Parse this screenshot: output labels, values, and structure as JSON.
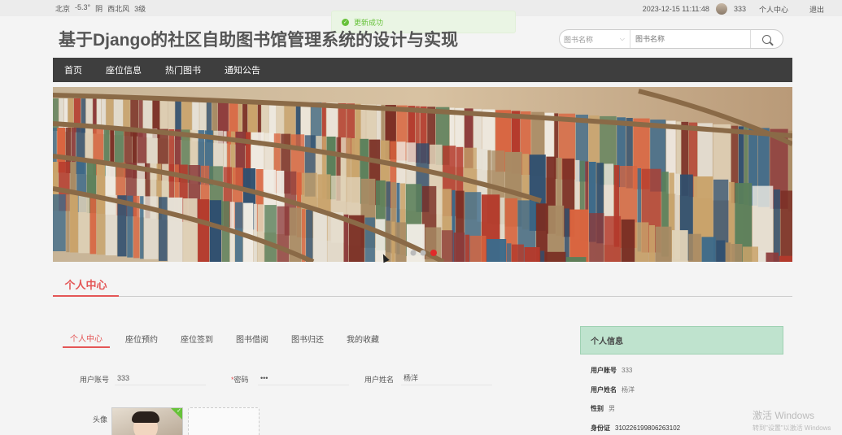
{
  "topbar": {
    "city": "北京",
    "temp": "-5.3°",
    "weather": "阴",
    "wind": "西北风",
    "wind_level": "3级",
    "datetime": "2023-12-15 11:11:48",
    "username": "333",
    "profile_link": "个人中心",
    "logout": "退出"
  },
  "toast": {
    "message": "更新成功"
  },
  "header": {
    "title": "基于Django的社区自助图书馆管理系统的设计与实现"
  },
  "search": {
    "select_value": "图书名称",
    "placeholder": "图书名称"
  },
  "nav": {
    "items": [
      "首页",
      "座位信息",
      "热门图书",
      "通知公告"
    ]
  },
  "banner": {
    "dot_count": 3,
    "active_dot": 2
  },
  "section": {
    "title": "个人中心"
  },
  "tabs": {
    "items": [
      "个人中心",
      "座位预约",
      "座位签到",
      "图书借阅",
      "图书归还",
      "我的收藏"
    ],
    "active": 0
  },
  "form": {
    "account_label": "用户账号",
    "account_value": "333",
    "password_label": "密码",
    "password_required": "*",
    "password_value": "•••",
    "name_label": "用户姓名",
    "name_value": "杨洋",
    "avatar_label": "头像"
  },
  "info": {
    "title": "个人信息",
    "rows": [
      {
        "label": "用户账号",
        "value": "333"
      },
      {
        "label": "用户姓名",
        "value": "杨洋"
      },
      {
        "label": "性别",
        "value": "男"
      },
      {
        "label": "身份证",
        "value": "310226199806263102"
      }
    ]
  },
  "watermark": {
    "line1": "激活 Windows",
    "line2": "转到\"设置\"以激活 Windows"
  },
  "colors": {
    "accent": "#e45656",
    "nav_bg": "#3e3e3e",
    "success": "#67c23a",
    "info_header": "#bfe3ce"
  }
}
